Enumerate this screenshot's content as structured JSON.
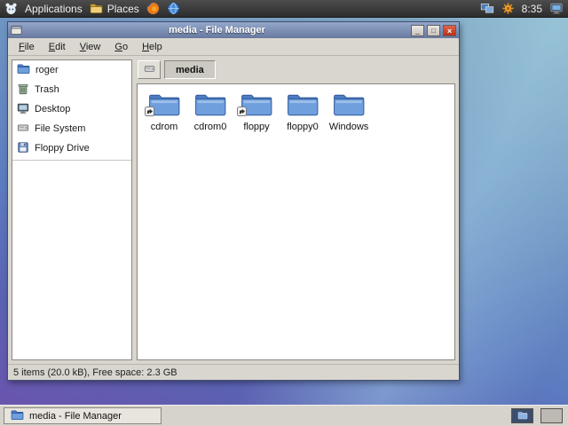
{
  "colors": {
    "titlebar_blue": "#7d92ba",
    "close_red": "#c84a32",
    "folder_blue": "#6f9fdc",
    "panel_dark": "#3a3a3a",
    "wallpaper_purple": "#6d52ac",
    "wallpaper_teal": "#8ab4c6"
  },
  "top_panel": {
    "applications": "Applications",
    "places": "Places",
    "clock": "8:35",
    "icons": [
      "xfce-menu-icon",
      "places-folder-icon",
      "firefox-icon",
      "globe-icon",
      "display-settings-icon",
      "gear-icon",
      "monitor-icon"
    ]
  },
  "window": {
    "title": "media - File Manager",
    "controls": {
      "minimize": "_",
      "maximize": "□",
      "close": "×"
    },
    "menu": [
      {
        "accel": "F",
        "rest": "ile"
      },
      {
        "accel": "E",
        "rest": "dit"
      },
      {
        "accel": "V",
        "rest": "iew"
      },
      {
        "accel": "G",
        "rest": "o"
      },
      {
        "accel": "H",
        "rest": "elp"
      }
    ],
    "sidebar": {
      "items": [
        {
          "label": "roger",
          "icon": "home-folder-icon"
        },
        {
          "label": "Trash",
          "icon": "trash-icon"
        },
        {
          "label": "Desktop",
          "icon": "desktop-icon"
        },
        {
          "label": "File System",
          "icon": "filesystem-icon"
        },
        {
          "label": "Floppy Drive",
          "icon": "floppy-icon"
        }
      ]
    },
    "pathbar": {
      "root_icon": "filesystem-icon",
      "current": "media"
    },
    "files": [
      {
        "name": "cdrom",
        "icon": "folder-icon",
        "symlink": true
      },
      {
        "name": "cdrom0",
        "icon": "folder-icon",
        "symlink": false
      },
      {
        "name": "floppy",
        "icon": "folder-icon",
        "symlink": true
      },
      {
        "name": "floppy0",
        "icon": "folder-icon",
        "symlink": false
      },
      {
        "name": "Windows",
        "icon": "folder-icon",
        "symlink": false
      }
    ],
    "statusbar": "5 items (20.0 kB), Free space: 2.3 GB"
  },
  "taskbar": {
    "task_label": "media - File Manager",
    "workspaces": 2,
    "active_workspace": 1
  }
}
